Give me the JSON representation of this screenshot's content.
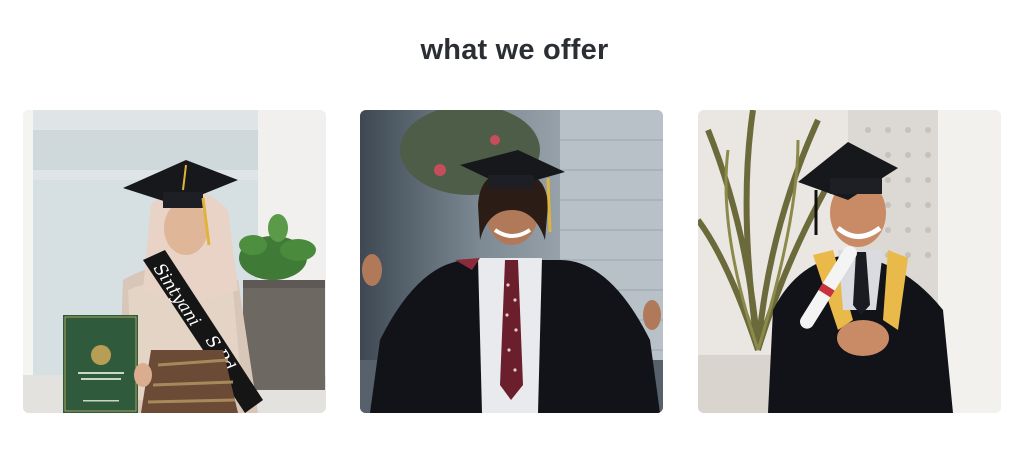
{
  "section": {
    "title": "what we offer"
  },
  "cards": [
    {
      "alt": "graduate-woman-with-diploma",
      "sash_text": "Sintyani",
      "sash_text2": "S.Pd"
    },
    {
      "alt": "graduate-man-arms-open"
    },
    {
      "alt": "graduate-man-holding-diploma"
    }
  ],
  "colors": {
    "title": "#2b2f33",
    "gown": "#111318",
    "cap": "#16181c",
    "tassel": "#e0b43a",
    "folder": "#2f5a3c"
  }
}
